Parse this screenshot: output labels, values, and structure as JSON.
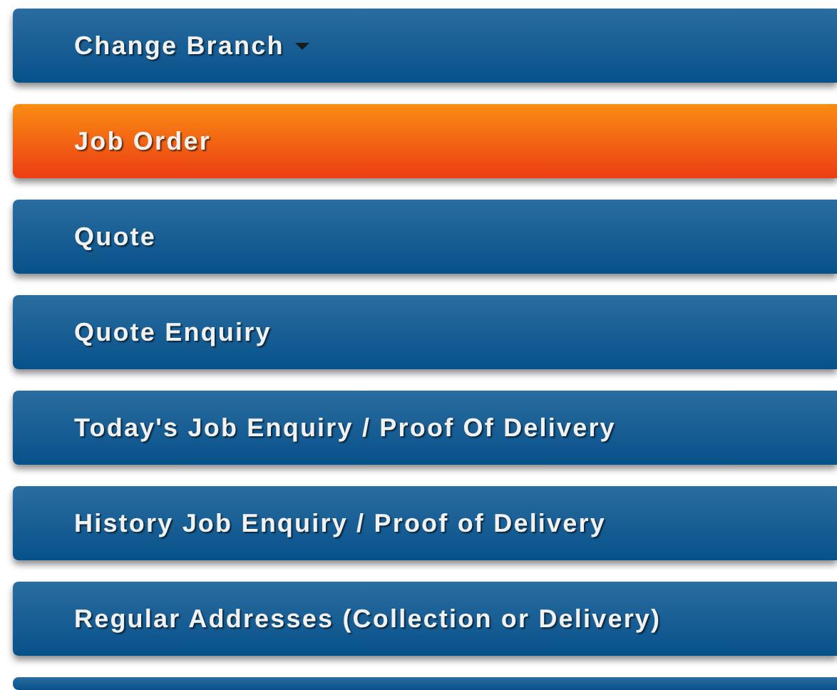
{
  "menu": [
    {
      "label": "Change Branch",
      "kind": "dropdown",
      "selected": false
    },
    {
      "label": "Job Order",
      "kind": "link",
      "selected": true
    },
    {
      "label": "Quote",
      "kind": "link",
      "selected": false
    },
    {
      "label": "Quote Enquiry",
      "kind": "link",
      "selected": false
    },
    {
      "label": "Today's Job Enquiry / Proof Of Delivery",
      "kind": "link",
      "selected": false
    },
    {
      "label": "History Job Enquiry / Proof of Delivery",
      "kind": "link",
      "selected": false
    },
    {
      "label": "Regular Addresses (Collection or Delivery)",
      "kind": "link",
      "selected": false
    }
  ],
  "more_below": true
}
